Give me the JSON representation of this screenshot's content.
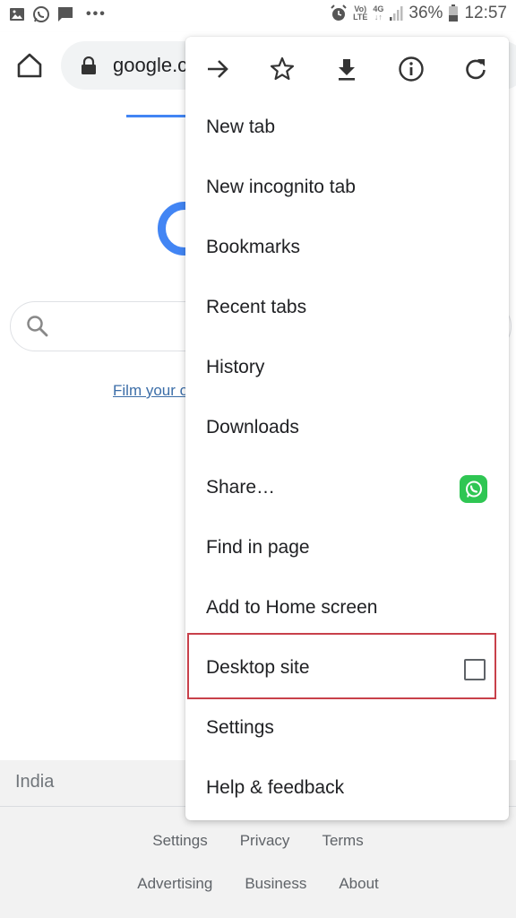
{
  "status_bar": {
    "notifications": [
      "gallery-icon",
      "whatsapp-icon",
      "message-icon"
    ],
    "more": "•••",
    "volte_top": "Vo)",
    "volte_bottom": "LTE",
    "network": "4G",
    "network_sub": "↓↑",
    "battery": "36%",
    "time": "12:57"
  },
  "toolbar": {
    "url": "google.com"
  },
  "page": {
    "promo_link": "Film your own stories",
    "footer": {
      "country": "India",
      "links_row1": [
        "Settings",
        "Privacy",
        "Terms"
      ],
      "links_row2": [
        "Advertising",
        "Business",
        "About"
      ]
    }
  },
  "menu": {
    "icon_row": [
      "forward-icon",
      "bookmark-star-icon",
      "download-icon",
      "info-icon",
      "refresh-icon"
    ],
    "items": [
      {
        "label": "New tab"
      },
      {
        "label": "New incognito tab"
      },
      {
        "label": "Bookmarks"
      },
      {
        "label": "Recent tabs"
      },
      {
        "label": "History"
      },
      {
        "label": "Downloads"
      },
      {
        "label": "Share…",
        "trailing": "whatsapp-icon"
      },
      {
        "label": "Find in page"
      },
      {
        "label": "Add to Home screen"
      },
      {
        "label": "Desktop site",
        "checked": false,
        "highlighted": true
      },
      {
        "label": "Settings"
      },
      {
        "label": "Help & feedback"
      }
    ],
    "highlight_color": "#c8404a"
  }
}
